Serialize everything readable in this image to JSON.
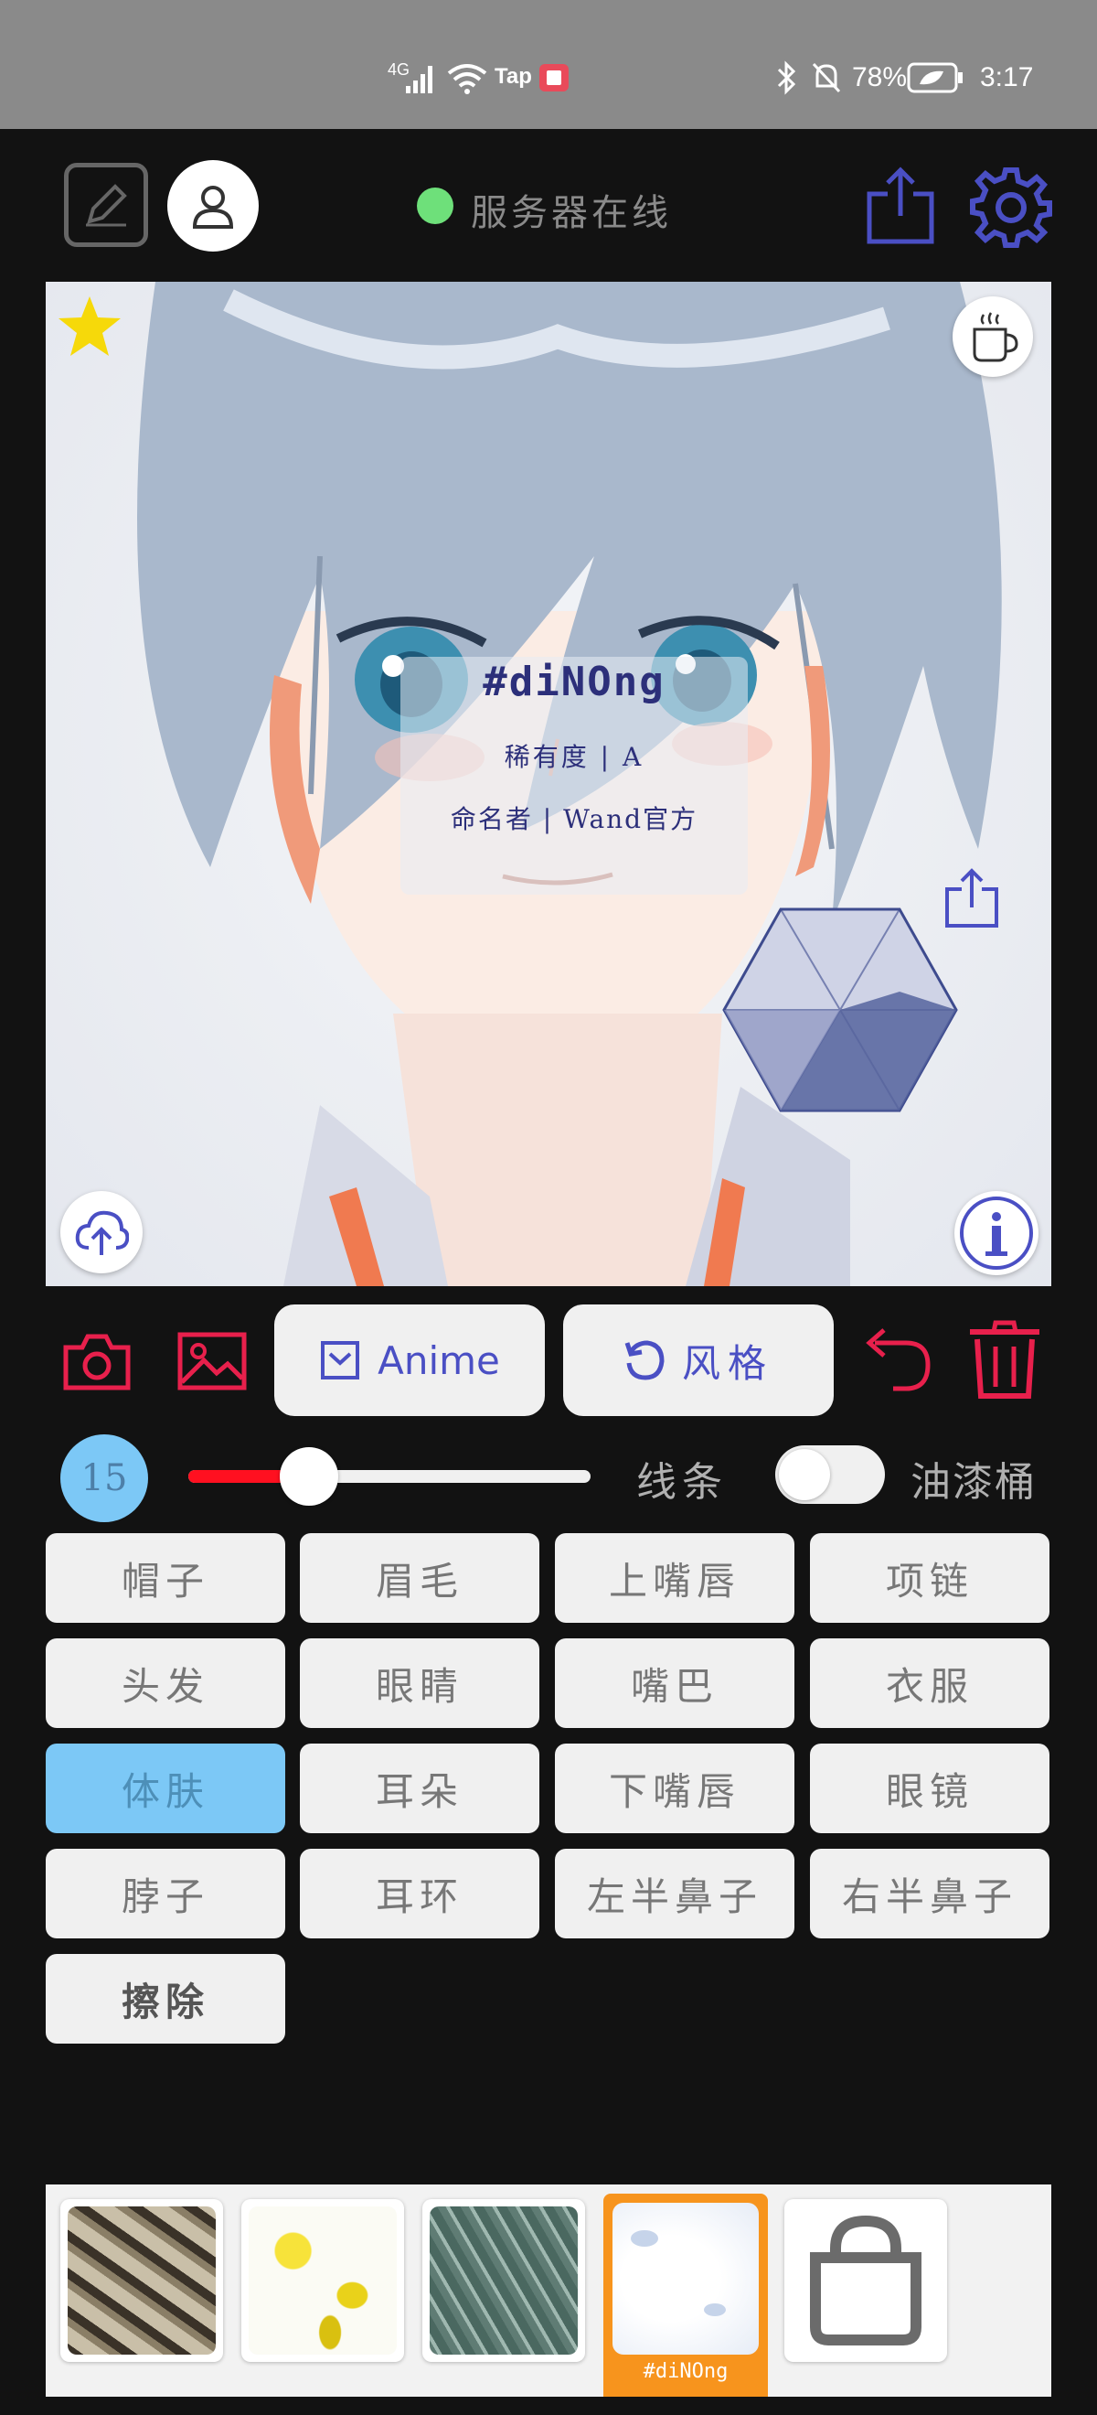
{
  "status_bar": {
    "network": "4G",
    "app_badge": "Tap",
    "battery": "78%",
    "time": "3:17"
  },
  "header": {
    "server_status": "服务器在线",
    "colors": {
      "online_dot": "#6ee07a",
      "accent": "#4a4fc4"
    }
  },
  "canvas": {
    "overlay": {
      "name": "#diNOng",
      "rarity": "稀有度 | A",
      "namer": "命名者 | Wand官方"
    }
  },
  "tools": {
    "mode_label": "Anime",
    "style_label": "风格",
    "colors": {
      "red": "#e8204c"
    }
  },
  "brush": {
    "size": "15",
    "slider_value_percent": 30,
    "line_label": "线条",
    "bucket_label": "油漆桶",
    "bucket_on": false
  },
  "parts": [
    {
      "label": "帽子"
    },
    {
      "label": "眉毛"
    },
    {
      "label": "上嘴唇"
    },
    {
      "label": "项链"
    },
    {
      "label": "头发"
    },
    {
      "label": "眼睛"
    },
    {
      "label": "嘴巴"
    },
    {
      "label": "衣服"
    },
    {
      "label": "体肤",
      "selected": true
    },
    {
      "label": "耳朵"
    },
    {
      "label": "下嘴唇"
    },
    {
      "label": "眼镜"
    },
    {
      "label": "脖子"
    },
    {
      "label": "耳环"
    },
    {
      "label": "左半鼻子"
    },
    {
      "label": "右半鼻子"
    },
    {
      "label": "擦除",
      "bold": true
    }
  ],
  "gallery": {
    "selected_label": "#diNOng",
    "selected_color": "#f7941d"
  }
}
